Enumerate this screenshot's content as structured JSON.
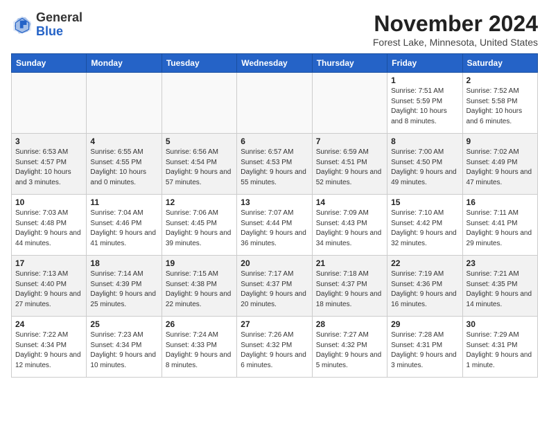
{
  "header": {
    "logo_general": "General",
    "logo_blue": "Blue",
    "month_title": "November 2024",
    "location": "Forest Lake, Minnesota, United States"
  },
  "days_of_week": [
    "Sunday",
    "Monday",
    "Tuesday",
    "Wednesday",
    "Thursday",
    "Friday",
    "Saturday"
  ],
  "weeks": [
    [
      {
        "day": "",
        "info": ""
      },
      {
        "day": "",
        "info": ""
      },
      {
        "day": "",
        "info": ""
      },
      {
        "day": "",
        "info": ""
      },
      {
        "day": "",
        "info": ""
      },
      {
        "day": "1",
        "info": "Sunrise: 7:51 AM\nSunset: 5:59 PM\nDaylight: 10 hours and 8 minutes."
      },
      {
        "day": "2",
        "info": "Sunrise: 7:52 AM\nSunset: 5:58 PM\nDaylight: 10 hours and 6 minutes."
      }
    ],
    [
      {
        "day": "3",
        "info": "Sunrise: 6:53 AM\nSunset: 4:57 PM\nDaylight: 10 hours and 3 minutes."
      },
      {
        "day": "4",
        "info": "Sunrise: 6:55 AM\nSunset: 4:55 PM\nDaylight: 10 hours and 0 minutes."
      },
      {
        "day": "5",
        "info": "Sunrise: 6:56 AM\nSunset: 4:54 PM\nDaylight: 9 hours and 57 minutes."
      },
      {
        "day": "6",
        "info": "Sunrise: 6:57 AM\nSunset: 4:53 PM\nDaylight: 9 hours and 55 minutes."
      },
      {
        "day": "7",
        "info": "Sunrise: 6:59 AM\nSunset: 4:51 PM\nDaylight: 9 hours and 52 minutes."
      },
      {
        "day": "8",
        "info": "Sunrise: 7:00 AM\nSunset: 4:50 PM\nDaylight: 9 hours and 49 minutes."
      },
      {
        "day": "9",
        "info": "Sunrise: 7:02 AM\nSunset: 4:49 PM\nDaylight: 9 hours and 47 minutes."
      }
    ],
    [
      {
        "day": "10",
        "info": "Sunrise: 7:03 AM\nSunset: 4:48 PM\nDaylight: 9 hours and 44 minutes."
      },
      {
        "day": "11",
        "info": "Sunrise: 7:04 AM\nSunset: 4:46 PM\nDaylight: 9 hours and 41 minutes."
      },
      {
        "day": "12",
        "info": "Sunrise: 7:06 AM\nSunset: 4:45 PM\nDaylight: 9 hours and 39 minutes."
      },
      {
        "day": "13",
        "info": "Sunrise: 7:07 AM\nSunset: 4:44 PM\nDaylight: 9 hours and 36 minutes."
      },
      {
        "day": "14",
        "info": "Sunrise: 7:09 AM\nSunset: 4:43 PM\nDaylight: 9 hours and 34 minutes."
      },
      {
        "day": "15",
        "info": "Sunrise: 7:10 AM\nSunset: 4:42 PM\nDaylight: 9 hours and 32 minutes."
      },
      {
        "day": "16",
        "info": "Sunrise: 7:11 AM\nSunset: 4:41 PM\nDaylight: 9 hours and 29 minutes."
      }
    ],
    [
      {
        "day": "17",
        "info": "Sunrise: 7:13 AM\nSunset: 4:40 PM\nDaylight: 9 hours and 27 minutes."
      },
      {
        "day": "18",
        "info": "Sunrise: 7:14 AM\nSunset: 4:39 PM\nDaylight: 9 hours and 25 minutes."
      },
      {
        "day": "19",
        "info": "Sunrise: 7:15 AM\nSunset: 4:38 PM\nDaylight: 9 hours and 22 minutes."
      },
      {
        "day": "20",
        "info": "Sunrise: 7:17 AM\nSunset: 4:37 PM\nDaylight: 9 hours and 20 minutes."
      },
      {
        "day": "21",
        "info": "Sunrise: 7:18 AM\nSunset: 4:37 PM\nDaylight: 9 hours and 18 minutes."
      },
      {
        "day": "22",
        "info": "Sunrise: 7:19 AM\nSunset: 4:36 PM\nDaylight: 9 hours and 16 minutes."
      },
      {
        "day": "23",
        "info": "Sunrise: 7:21 AM\nSunset: 4:35 PM\nDaylight: 9 hours and 14 minutes."
      }
    ],
    [
      {
        "day": "24",
        "info": "Sunrise: 7:22 AM\nSunset: 4:34 PM\nDaylight: 9 hours and 12 minutes."
      },
      {
        "day": "25",
        "info": "Sunrise: 7:23 AM\nSunset: 4:34 PM\nDaylight: 9 hours and 10 minutes."
      },
      {
        "day": "26",
        "info": "Sunrise: 7:24 AM\nSunset: 4:33 PM\nDaylight: 9 hours and 8 minutes."
      },
      {
        "day": "27",
        "info": "Sunrise: 7:26 AM\nSunset: 4:32 PM\nDaylight: 9 hours and 6 minutes."
      },
      {
        "day": "28",
        "info": "Sunrise: 7:27 AM\nSunset: 4:32 PM\nDaylight: 9 hours and 5 minutes."
      },
      {
        "day": "29",
        "info": "Sunrise: 7:28 AM\nSunset: 4:31 PM\nDaylight: 9 hours and 3 minutes."
      },
      {
        "day": "30",
        "info": "Sunrise: 7:29 AM\nSunset: 4:31 PM\nDaylight: 9 hours and 1 minute."
      }
    ]
  ]
}
